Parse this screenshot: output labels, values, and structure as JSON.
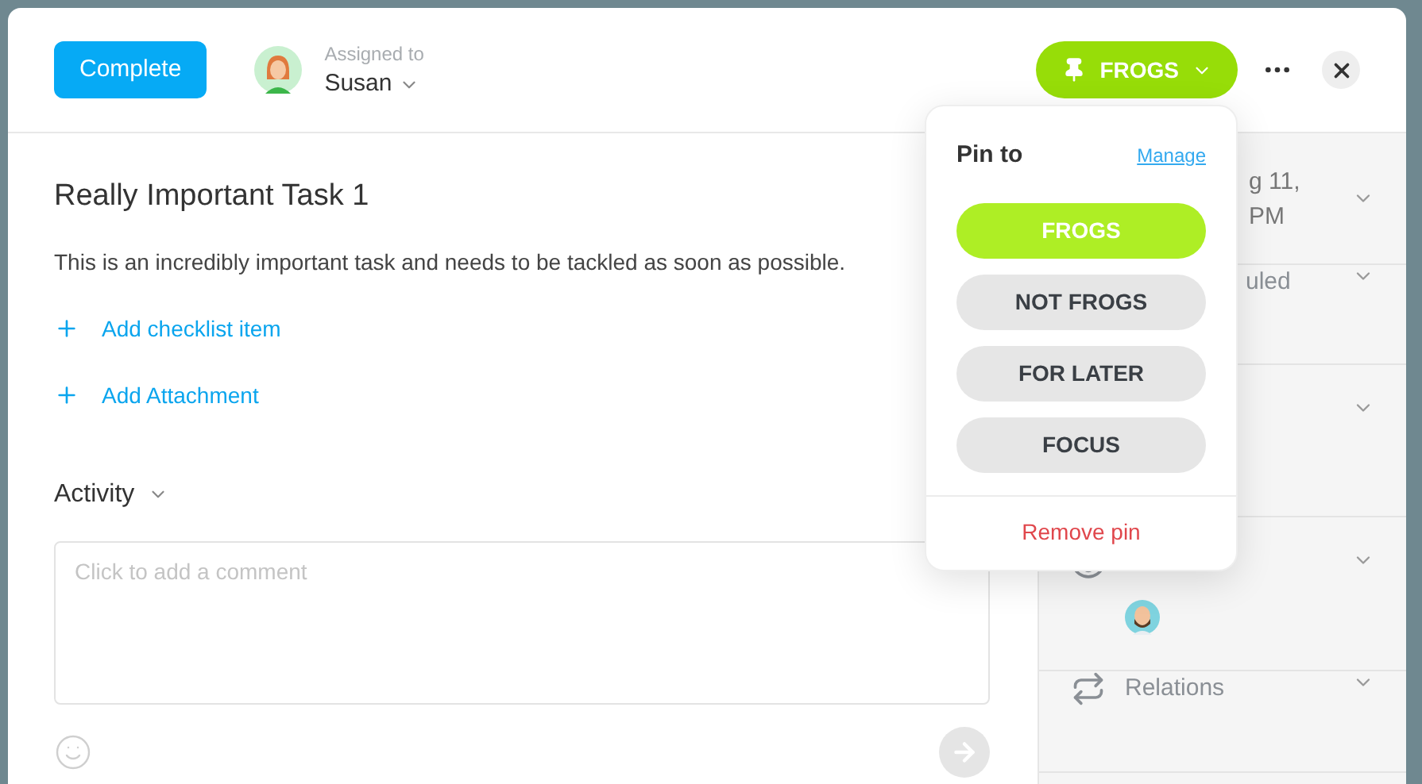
{
  "header": {
    "complete_button": "Complete",
    "assigned_label": "Assigned to",
    "assignee": "Susan",
    "pin_button": "FROGS"
  },
  "task": {
    "title": "Really Important Task 1",
    "description": "This is an incredibly important task and needs to be tackled as soon as possible.",
    "actions": [
      "Add checklist item",
      "Add Attachment"
    ]
  },
  "activity": {
    "label": "Activity",
    "comment_placeholder": "Click to add a comment"
  },
  "sidebar": {
    "sections": [
      {
        "kind": "date",
        "lines": [
          "g 11,",
          "PM"
        ]
      },
      {
        "kind": "schedule",
        "lines": [
          "uled"
        ]
      },
      {
        "kind": "blank"
      },
      {
        "kind": "watching"
      },
      {
        "kind": "relations",
        "lines": [
          "Relations"
        ]
      }
    ]
  },
  "pin_menu": {
    "title": "Pin to",
    "manage_link": "Manage",
    "options": [
      {
        "label": "FROGS",
        "selected": true
      },
      {
        "label": "NOT FROGS",
        "selected": false
      },
      {
        "label": "FOR LATER",
        "selected": false
      },
      {
        "label": "FOCUS",
        "selected": false
      }
    ],
    "remove": "Remove pin"
  }
}
